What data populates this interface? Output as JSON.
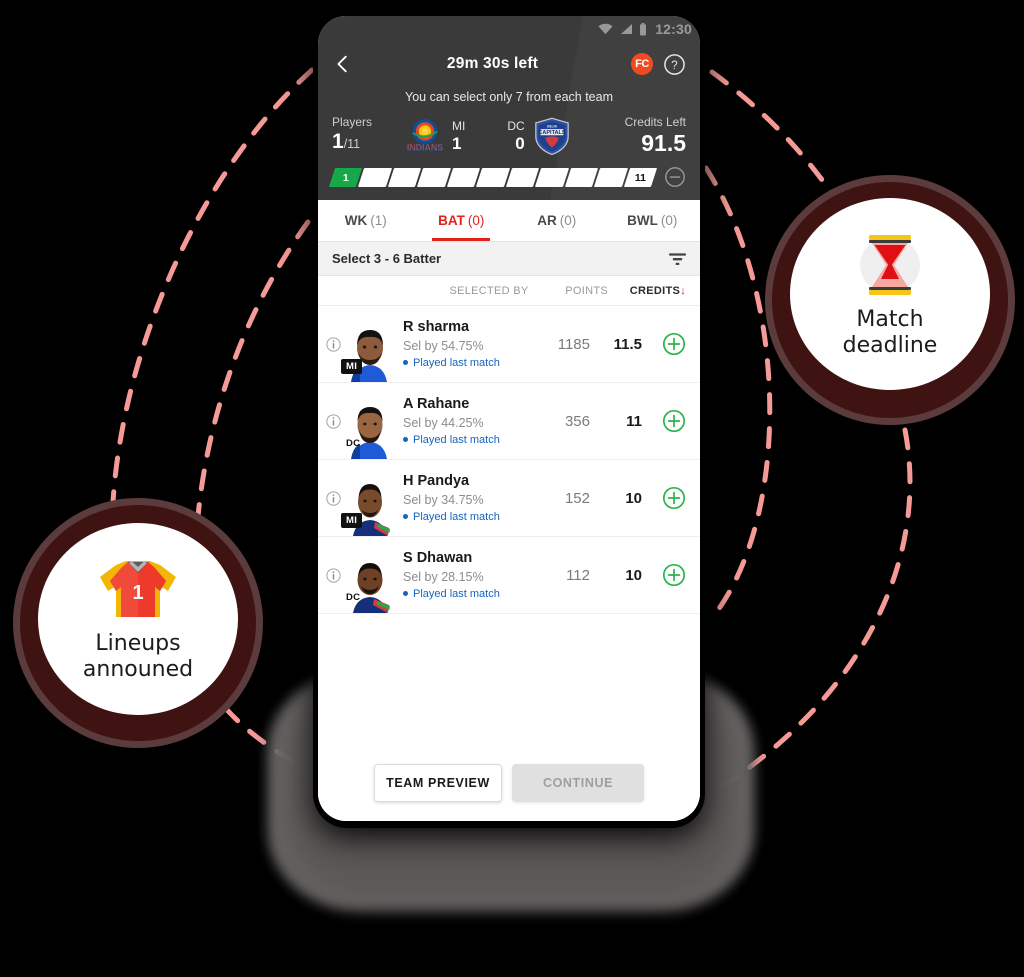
{
  "status_bar": {
    "time": "12:30",
    "icons": [
      "wifi-icon",
      "signal-icon",
      "battery-icon"
    ]
  },
  "header": {
    "back_icon": "back-chevron-icon",
    "deadline_text": "29m 30s left",
    "fc_badge": "FC",
    "help_icon": "help-circle-icon",
    "hint_text": "You can select only 7 from each team",
    "players_label": "Players",
    "players_count": "1",
    "players_total": "/11",
    "team_left": {
      "code": "MI",
      "name": "Mumbai Indians",
      "count": "1"
    },
    "team_right": {
      "code": "DC",
      "name": "Delhi Capitals",
      "count": "0"
    },
    "credits_label": "Credits Left",
    "credits_value": "91.5",
    "progress": {
      "segments_total": 11,
      "filled": 1,
      "first_label": "1",
      "last_label": "11",
      "remove_icon": "minus-circle-icon",
      "filled_color": "#17a84a"
    }
  },
  "tabs": [
    {
      "label": "WK",
      "count": "(1)",
      "active": false
    },
    {
      "label": "BAT",
      "count": "(0)",
      "active": true
    },
    {
      "label": "AR",
      "count": "(0)",
      "active": false
    },
    {
      "label": "BWL",
      "count": "(0)",
      "active": false
    }
  ],
  "select_bar": {
    "text": "Select 3 - 6 Batter",
    "filter_icon": "filter-icon"
  },
  "columns": {
    "selected_by": "SELECTED BY",
    "points": "POINTS",
    "credits": "CREDITS",
    "credits_sort_arrow": "↓"
  },
  "players": [
    {
      "name": "R sharma",
      "selected_by": "Sel by  54.75%",
      "note": "Played last match",
      "points": "1185",
      "credits": "11.5",
      "team": "MI",
      "team_tag_dark": true,
      "add_icon": "plus-circle-icon",
      "info_icon": "info-circle-icon"
    },
    {
      "name": "A Rahane",
      "selected_by": "Sel by  44.25%",
      "note": "Played last match",
      "points": "356",
      "credits": "11",
      "team": "DC",
      "team_tag_dark": false,
      "add_icon": "plus-circle-icon",
      "info_icon": "info-circle-icon"
    },
    {
      "name": "H Pandya",
      "selected_by": "Sel by  34.75%",
      "note": "Played last match",
      "points": "152",
      "credits": "10",
      "team": "MI",
      "team_tag_dark": true,
      "add_icon": "plus-circle-icon",
      "info_icon": "info-circle-icon"
    },
    {
      "name": "S Dhawan",
      "selected_by": "Sel by  28.15%",
      "note": "Played last match",
      "points": "112",
      "credits": "10",
      "team": "DC",
      "team_tag_dark": false,
      "add_icon": "plus-circle-icon",
      "info_icon": "info-circle-icon"
    }
  ],
  "footer": {
    "team_preview_label": "TEAM PREVIEW",
    "continue_label": "CONTINUE"
  },
  "callouts": {
    "left": {
      "line1": "Lineups",
      "line2": "announed",
      "icon": "jersey-icon",
      "jersey_number": "1"
    },
    "right": {
      "line1": "Match",
      "line2": "deadline",
      "icon": "hourglass-icon"
    }
  },
  "colors": {
    "accent_red": "#e2231a",
    "green": "#17a84a",
    "dark_header": "#3a3a3a",
    "bubble_ring": "#401313",
    "dashed_line": "#f59a96",
    "link_blue": "#1565c0"
  }
}
